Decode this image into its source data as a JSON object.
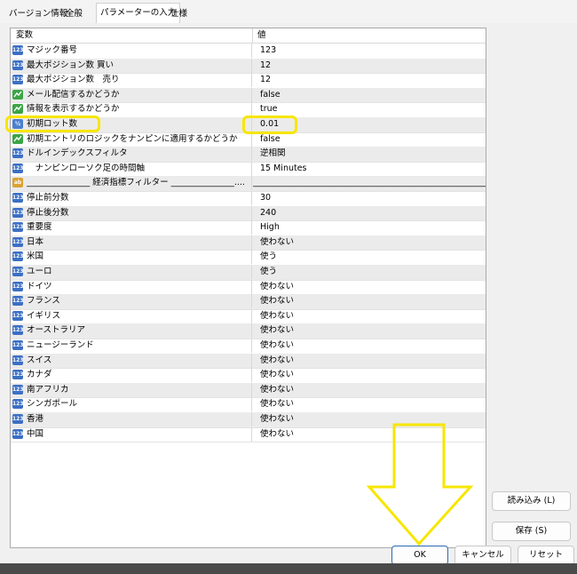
{
  "tabs": [
    {
      "label": "バージョン情報"
    },
    {
      "label": "全般"
    },
    {
      "label": "パラメーターの入力"
    },
    {
      "label": "仕様"
    }
  ],
  "grid": {
    "header_variable": "変数",
    "header_value": "値",
    "rows": [
      {
        "type": "num",
        "icon": "123",
        "name": "マジック番号",
        "value": "123"
      },
      {
        "type": "num",
        "icon": "123",
        "name": "最大ポジション数 買い",
        "value": "12"
      },
      {
        "type": "num",
        "icon": "123",
        "name": "最大ポジション数　売り",
        "value": "12"
      },
      {
        "type": "bool",
        "icon": "",
        "name": "メール配信するかどうか",
        "value": "false"
      },
      {
        "type": "bool",
        "icon": "",
        "name": "情報を表示するかどうか",
        "value": "true"
      },
      {
        "type": "dbl",
        "icon": "½",
        "name": "初期ロット数",
        "value": "0.01"
      },
      {
        "type": "bool",
        "icon": "",
        "name": "初期エントリのロジックをナンピンに適用するかどうか",
        "value": "false"
      },
      {
        "type": "num",
        "icon": "123",
        "name": "ドルインデックスフィルタ",
        "value": "逆相関"
      },
      {
        "type": "num",
        "icon": "123",
        "name": "　ナンピンローソク足の時間軸",
        "value": "15 Minutes"
      },
      {
        "type": "str",
        "icon": "ab",
        "name": "_______________ 経済指標フィルター _______________....",
        "value": "________________________________________________________________..."
      },
      {
        "type": "num",
        "icon": "123",
        "name": "停止前分数",
        "value": "30"
      },
      {
        "type": "num",
        "icon": "123",
        "name": "停止後分数",
        "value": "240"
      },
      {
        "type": "num",
        "icon": "123",
        "name": "重要度",
        "value": "High"
      },
      {
        "type": "num",
        "icon": "123",
        "name": "日本",
        "value": "使わない"
      },
      {
        "type": "num",
        "icon": "123",
        "name": "米国",
        "value": "使う"
      },
      {
        "type": "num",
        "icon": "123",
        "name": "ユーロ",
        "value": "使う"
      },
      {
        "type": "num",
        "icon": "123",
        "name": "ドイツ",
        "value": "使わない"
      },
      {
        "type": "num",
        "icon": "123",
        "name": "フランス",
        "value": "使わない"
      },
      {
        "type": "num",
        "icon": "123",
        "name": "イギリス",
        "value": "使わない"
      },
      {
        "type": "num",
        "icon": "123",
        "name": "オーストラリア",
        "value": "使わない"
      },
      {
        "type": "num",
        "icon": "123",
        "name": "ニュージーランド",
        "value": "使わない"
      },
      {
        "type": "num",
        "icon": "123",
        "name": "スイス",
        "value": "使わない"
      },
      {
        "type": "num",
        "icon": "123",
        "name": "カナダ",
        "value": "使わない"
      },
      {
        "type": "num",
        "icon": "123",
        "name": "南アフリカ",
        "value": "使わない"
      },
      {
        "type": "num",
        "icon": "123",
        "name": "シンガポール",
        "value": "使わない"
      },
      {
        "type": "num",
        "icon": "123",
        "name": "香港",
        "value": "使わない"
      },
      {
        "type": "num",
        "icon": "123",
        "name": "中国",
        "value": "使わない"
      }
    ]
  },
  "buttons": {
    "load": "読み込み (L)",
    "save": "保存 (S)",
    "ok": "OK",
    "cancel": "キャンセル",
    "reset": "リセット"
  },
  "colors": {
    "highlight": "#f7e600",
    "ok_border": "#2b6ab5"
  }
}
